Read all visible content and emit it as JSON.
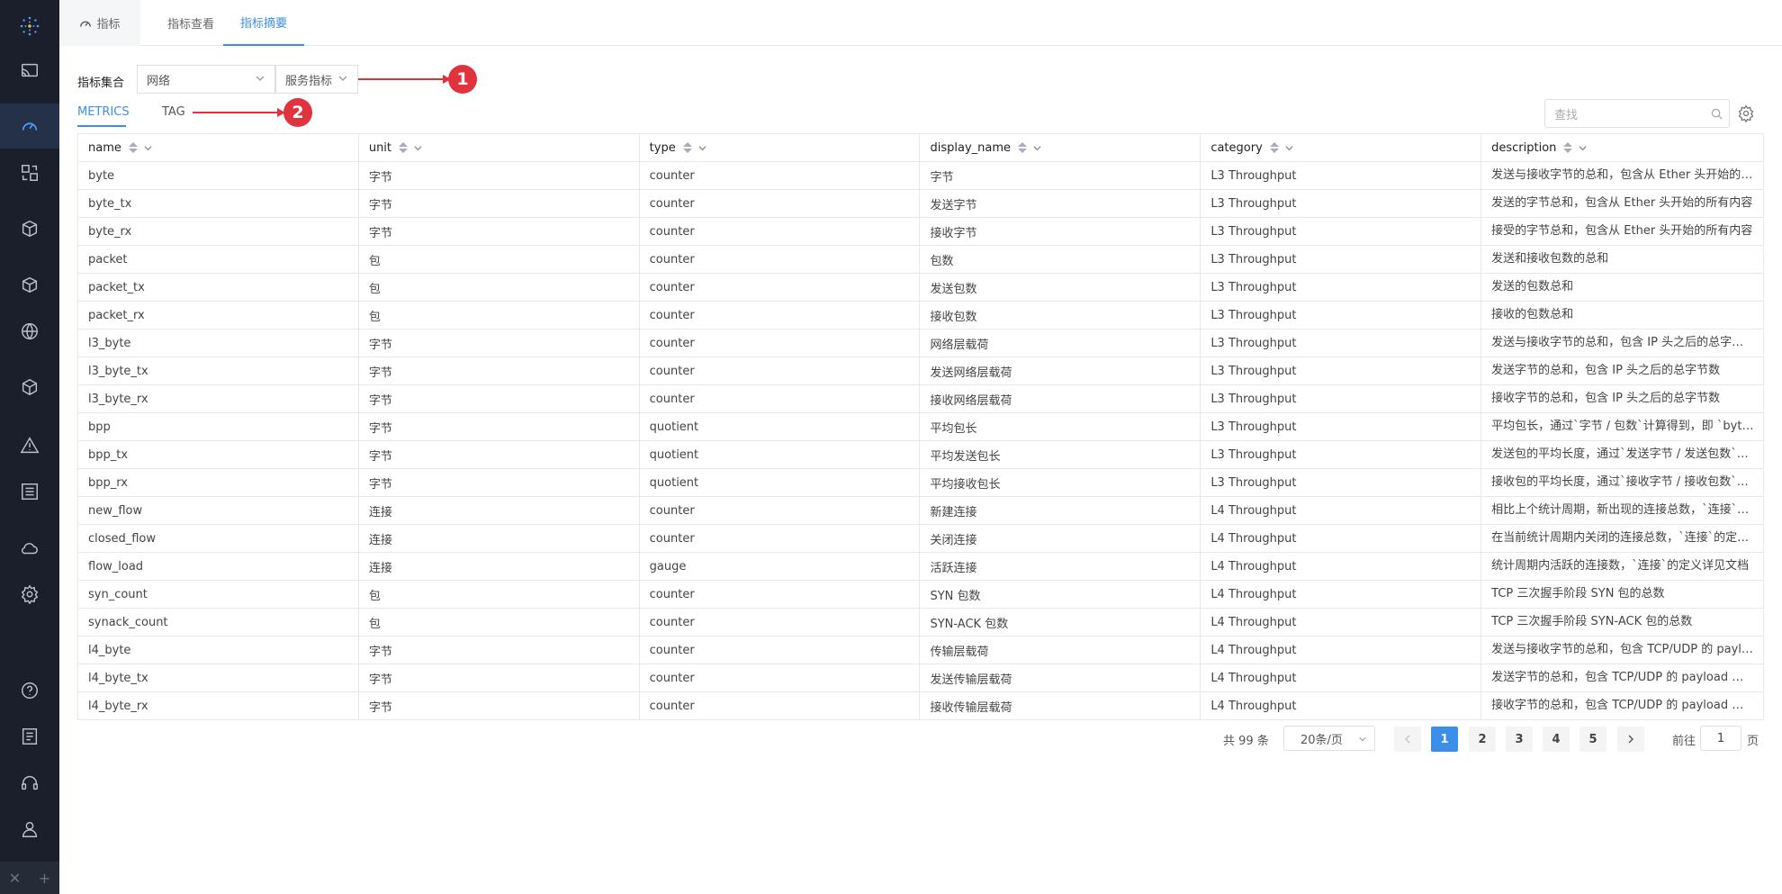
{
  "top_tabs": [
    {
      "label": "指标"
    },
    {
      "label": "指标查看"
    },
    {
      "label": "指标摘要"
    }
  ],
  "filter": {
    "label": "指标集合",
    "select1": "网络",
    "select2": "服务指标"
  },
  "annotations": [
    "1",
    "2"
  ],
  "sub_tabs": [
    "METRICS",
    "TAG"
  ],
  "search": {
    "placeholder": "查找"
  },
  "table": {
    "columns": [
      "name",
      "unit",
      "type",
      "display_name",
      "category",
      "description"
    ],
    "rows": [
      [
        "byte",
        "字节",
        "counter",
        "字节",
        "L3 Throughput",
        "发送与接收字节的总和，包含从 Ether 头开始的所有内容"
      ],
      [
        "byte_tx",
        "字节",
        "counter",
        "发送字节",
        "L3 Throughput",
        "发送的字节总和，包含从 Ether 头开始的所有内容"
      ],
      [
        "byte_rx",
        "字节",
        "counter",
        "接收字节",
        "L3 Throughput",
        "接受的字节总和，包含从 Ether 头开始的所有内容"
      ],
      [
        "packet",
        "包",
        "counter",
        "包数",
        "L3 Throughput",
        "发送和接收包数的总和"
      ],
      [
        "packet_tx",
        "包",
        "counter",
        "发送包数",
        "L3 Throughput",
        "发送的包数总和"
      ],
      [
        "packet_rx",
        "包",
        "counter",
        "接收包数",
        "L3 Throughput",
        "接收的包数总和"
      ],
      [
        "l3_byte",
        "字节",
        "counter",
        "网络层载荷",
        "L3 Throughput",
        "发送与接收字节的总和，包含 IP 头之后的总字节数"
      ],
      [
        "l3_byte_tx",
        "字节",
        "counter",
        "发送网络层载荷",
        "L3 Throughput",
        "发送字节的总和，包含 IP 头之后的总字节数"
      ],
      [
        "l3_byte_rx",
        "字节",
        "counter",
        "接收网络层载荷",
        "L3 Throughput",
        "接收字节的总和，包含 IP 头之后的总字节数"
      ],
      [
        "bpp",
        "字节",
        "quotient",
        "平均包长",
        "L3 Throughput",
        "平均包长，通过`字节 / 包数`计算得到，即 `byte / packet`"
      ],
      [
        "bpp_tx",
        "字节",
        "quotient",
        "平均发送包长",
        "L3 Throughput",
        "发送包的平均长度，通过`发送字节 / 发送包数`计算得到"
      ],
      [
        "bpp_rx",
        "字节",
        "quotient",
        "平均接收包长",
        "L3 Throughput",
        "接收包的平均长度，通过`接收字节 / 接收包数`计算得到"
      ],
      [
        "new_flow",
        "连接",
        "counter",
        "新建连接",
        "L4 Throughput",
        "相比上个统计周期，新出现的连接总数，`连接`的定义详见文档"
      ],
      [
        "closed_flow",
        "连接",
        "counter",
        "关闭连接",
        "L4 Throughput",
        "在当前统计周期内关闭的连接总数，`连接`的定义详见文档"
      ],
      [
        "flow_load",
        "连接",
        "gauge",
        "活跃连接",
        "L4 Throughput",
        "统计周期内活跃的连接数，`连接`的定义详见文档"
      ],
      [
        "syn_count",
        "包",
        "counter",
        "SYN 包数",
        "L4 Throughput",
        "TCP 三次握手阶段 SYN 包的总数"
      ],
      [
        "synack_count",
        "包",
        "counter",
        "SYN-ACK 包数",
        "L4 Throughput",
        "TCP 三次握手阶段 SYN-ACK 包的总数"
      ],
      [
        "l4_byte",
        "字节",
        "counter",
        "传输层载荷",
        "L4 Throughput",
        "发送与接收字节的总和，包含 TCP/UDP 的 payload 部分"
      ],
      [
        "l4_byte_tx",
        "字节",
        "counter",
        "发送传输层载荷",
        "L4 Throughput",
        "发送字节的总和，包含 TCP/UDP 的 payload 部分"
      ],
      [
        "l4_byte_rx",
        "字节",
        "counter",
        "接收传输层载荷",
        "L4 Throughput",
        "接收字节的总和，包含 TCP/UDP 的 payload 部分"
      ]
    ]
  },
  "pagination": {
    "total": "共 99 条",
    "page_size": "20条/页",
    "pages": [
      "1",
      "2",
      "3",
      "4",
      "5"
    ],
    "current": "1",
    "goto_prefix": "前往",
    "goto_value": "1",
    "goto_suffix": "页"
  },
  "colors": {
    "accent": "#3b8fe8",
    "sidebar_bg": "#1b1f2b",
    "annotation": "#e0333d"
  },
  "sidebar_icons": [
    "cast-icon",
    "dashboard-icon",
    "exchange-icon",
    "box-icon",
    "package-icon",
    "globe-icon",
    "cube-icon",
    "alert-icon",
    "list-icon",
    "cloud-icon",
    "settings-icon",
    "help-icon",
    "document-icon",
    "headset-icon",
    "user-icon"
  ]
}
